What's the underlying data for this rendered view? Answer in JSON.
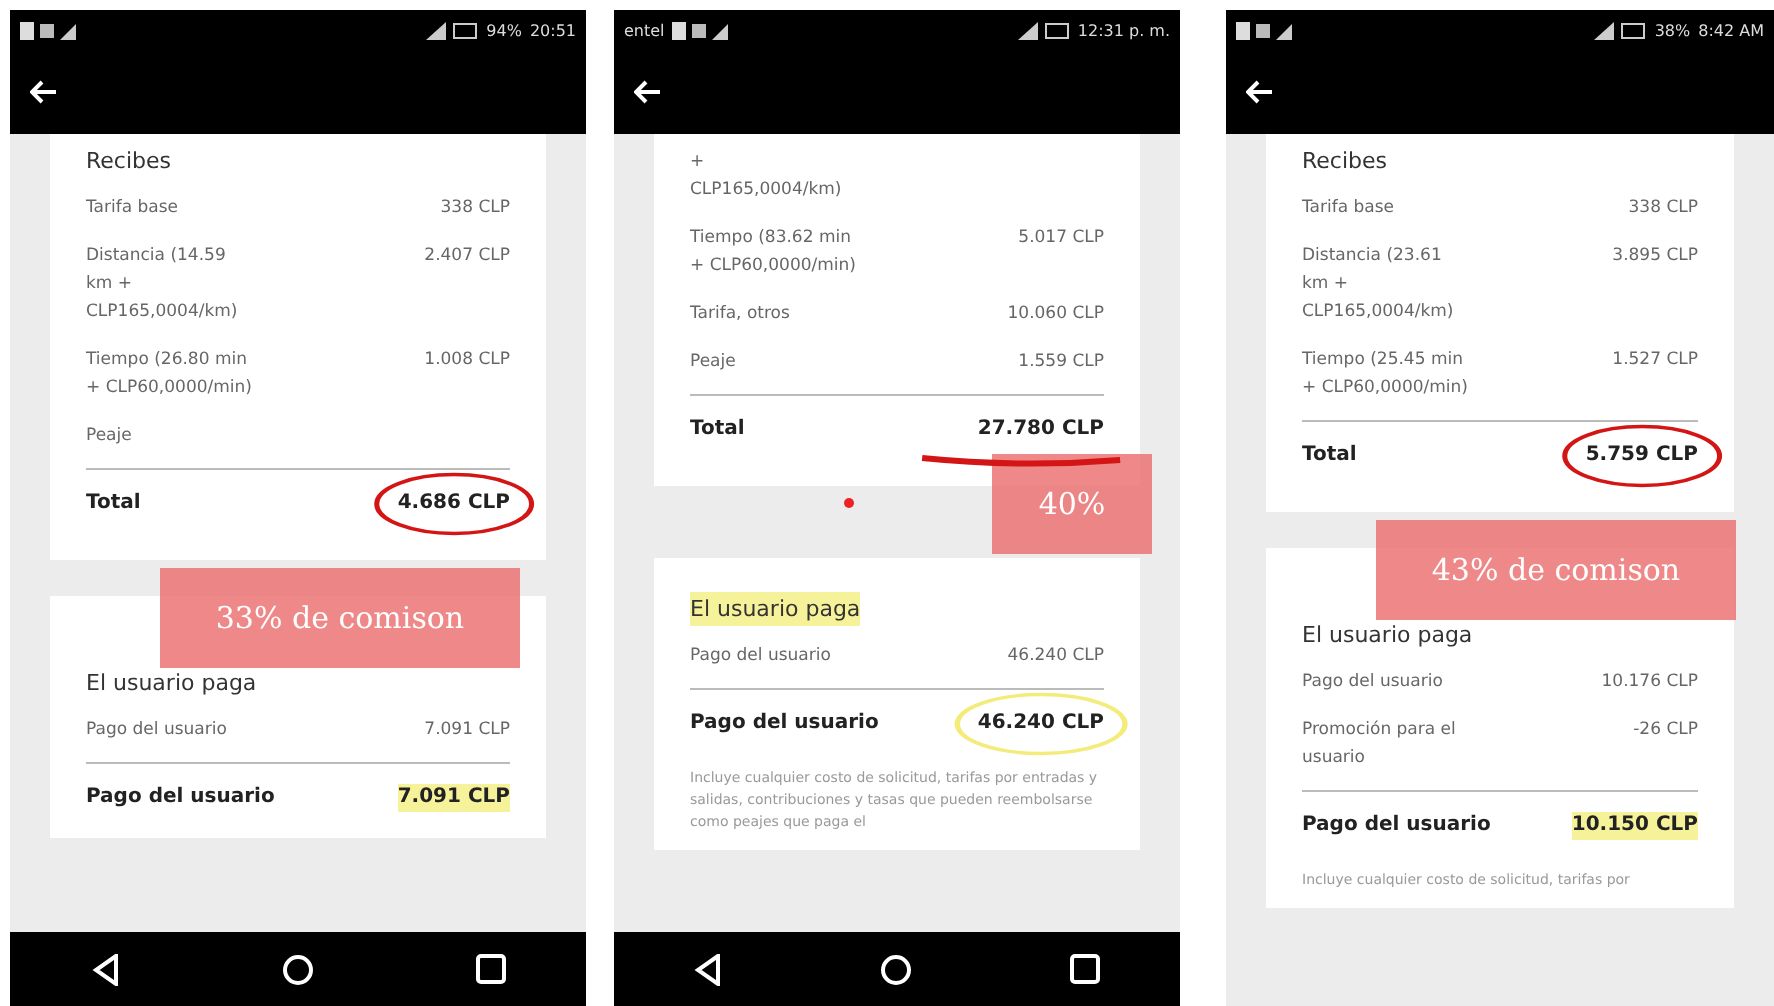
{
  "phones": [
    {
      "status": {
        "battery": "94%",
        "time": "20:51"
      },
      "nav_bar": true,
      "red_dot": false,
      "note": "33% de comison",
      "sections": [
        {
          "title": "Recibes",
          "rows": [
            {
              "kind": "line",
              "label": "Tarifa base",
              "value": "338 CLP"
            },
            {
              "kind": "line",
              "label": "Distancia (14.59 km + CLP165,0004/km)",
              "value": "2.407 CLP"
            },
            {
              "kind": "line",
              "label": "Tiempo (26.80 min + CLP60,0000/min)",
              "value": "1.008 CLP"
            },
            {
              "kind": "line",
              "label": "Peaje"
            },
            {
              "kind": "total",
              "label": "Total",
              "value": "4.686 CLP",
              "mark": {
                "kind": "circle",
                "color": "#d41515"
              }
            }
          ]
        },
        {
          "title": "El usuario paga",
          "rows": [
            {
              "kind": "line",
              "label": "Pago del usuario",
              "value": "7.091 CLP"
            },
            {
              "kind": "total",
              "label": "Pago del usuario",
              "value": "7.091 CLP",
              "mark": {
                "kind": "highlight",
                "color": "#f6f29a"
              }
            }
          ]
        }
      ]
    },
    {
      "status": {
        "carrier": "entel",
        "time": "12:31 p. m."
      },
      "nav_bar": true,
      "red_dot": true,
      "note": "40%",
      "sections": [
        {
          "rows": [
            {
              "kind": "line",
              "label": "+ CLP165,0004/km)"
            },
            {
              "kind": "line",
              "label": "Tiempo (83.62 min + CLP60,0000/min)",
              "value": "5.017 CLP"
            },
            {
              "kind": "line",
              "label": "Tarifa, otros",
              "value": "10.060 CLP"
            },
            {
              "kind": "line",
              "label": "Peaje",
              "value": "1.559 CLP"
            },
            {
              "kind": "total",
              "label": "Total",
              "value": "27.780 CLP",
              "mark": {
                "kind": "underline",
                "color": "#d41515"
              }
            }
          ]
        },
        {
          "title": "El usuario paga",
          "title_mark": {
            "kind": "highlight",
            "color": "#f6f29a"
          },
          "rows": [
            {
              "kind": "line",
              "label": "Pago del usuario",
              "value": "46.240 CLP"
            },
            {
              "kind": "total",
              "label": "Pago del usuario",
              "value": "46.240 CLP",
              "mark": {
                "kind": "circle",
                "color": "#f3ec7a"
              }
            }
          ]
        }
      ],
      "footnote": "Incluye cualquier costo de solicitud, tarifas por entradas y salidas, contribuciones y tasas que pueden reembolsarse como peajes que paga el"
    },
    {
      "status": {
        "battery": "38%",
        "time": "8:42 AM"
      },
      "nav_bar": false,
      "red_dot": false,
      "note": "43% de comison",
      "sections": [
        {
          "title": "Recibes",
          "rows": [
            {
              "kind": "line",
              "label": "Tarifa base",
              "value": "338 CLP"
            },
            {
              "kind": "line",
              "label": "Distancia (23.61 km + CLP165,0004/km)",
              "value": "3.895 CLP"
            },
            {
              "kind": "line",
              "label": "Tiempo (25.45 min + CLP60,0000/min)",
              "value": "1.527 CLP"
            },
            {
              "kind": "total",
              "label": "Total",
              "value": "5.759 CLP",
              "mark": {
                "kind": "circle",
                "color": "#d41515"
              }
            }
          ]
        },
        {
          "title": "El usuario paga",
          "rows": [
            {
              "kind": "line",
              "label": "Pago del usuario",
              "value": "10.176 CLP"
            },
            {
              "kind": "line",
              "label": "Promoción para el usuario",
              "value": "-26 CLP"
            },
            {
              "kind": "total",
              "label": "Pago del usuario",
              "value": "10.150 CLP",
              "mark": {
                "kind": "highlight",
                "color": "#f6f29a"
              }
            }
          ]
        }
      ],
      "footnote": "Incluye cualquier costo de solicitud, tarifas por"
    }
  ]
}
